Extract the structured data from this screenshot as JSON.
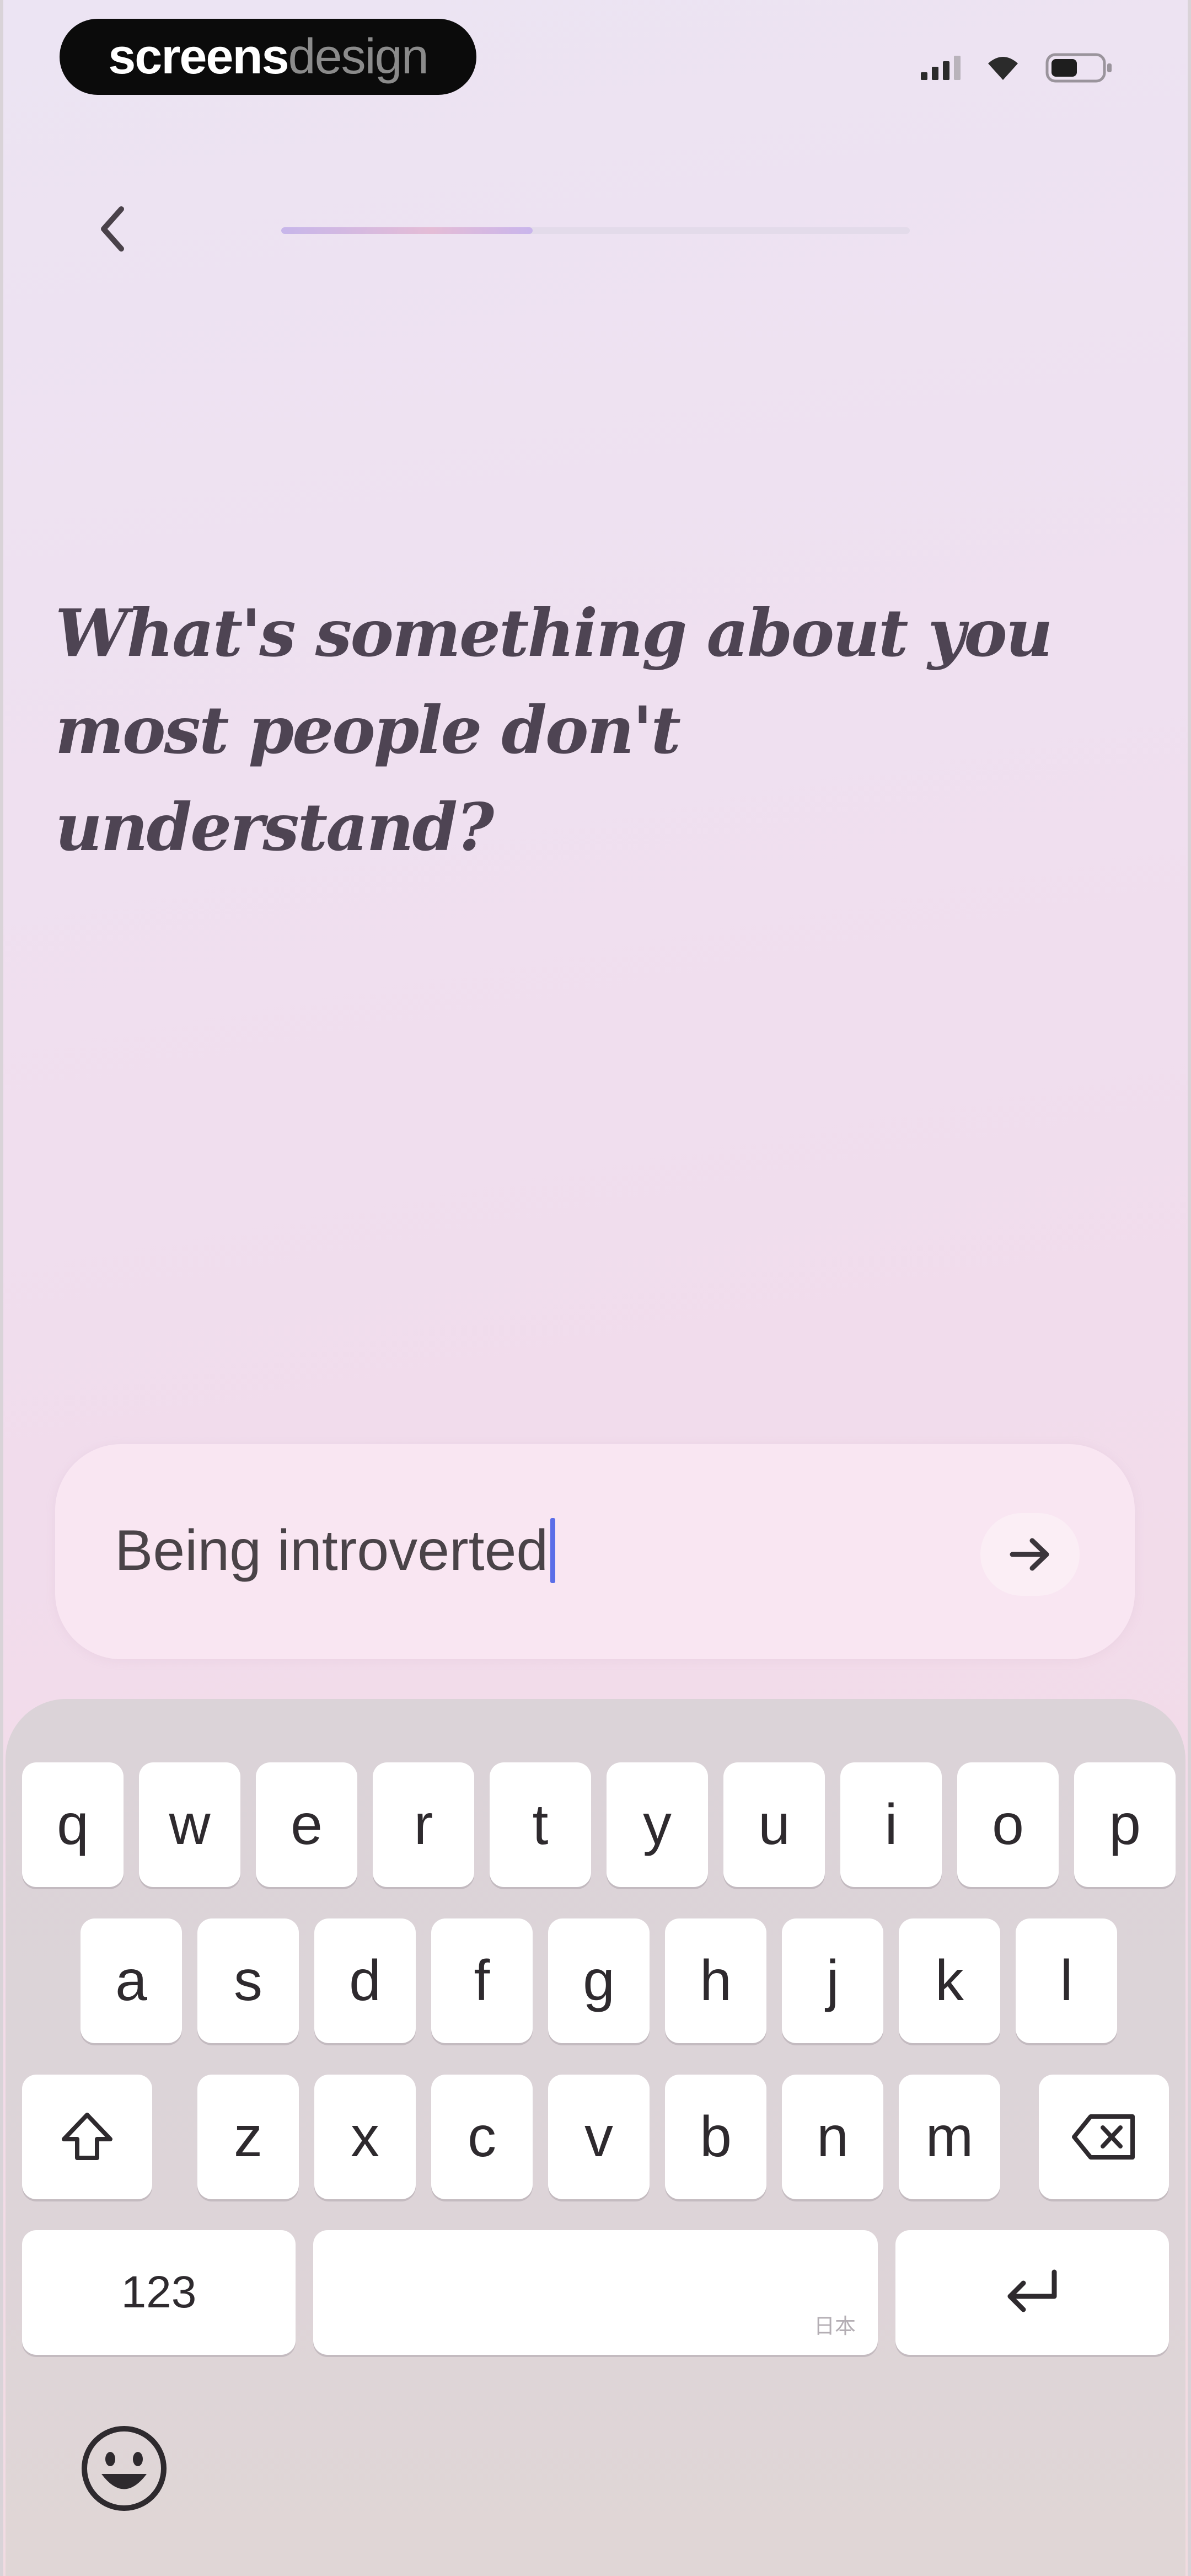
{
  "status_bar": {
    "brand_strong": "screens",
    "brand_light": "design",
    "icons": [
      "cellular-signal-icon",
      "wifi-icon",
      "battery-icon"
    ]
  },
  "header": {
    "back_icon": "chevron-left-icon",
    "progress": 0.4
  },
  "question": {
    "text": "What's something about you most people don't understand?"
  },
  "answer": {
    "value": "Being introverted",
    "send_icon": "arrow-right-icon"
  },
  "keyboard": {
    "row1": [
      "q",
      "w",
      "e",
      "r",
      "t",
      "y",
      "u",
      "i",
      "o",
      "p"
    ],
    "row2": [
      "a",
      "s",
      "d",
      "f",
      "g",
      "h",
      "j",
      "k",
      "l"
    ],
    "row3": [
      "z",
      "x",
      "c",
      "v",
      "b",
      "n",
      "m"
    ],
    "numbers_key": "123",
    "space_hint": "日本",
    "shift_icon": "shift-icon",
    "delete_icon": "backspace-icon",
    "return_icon": "return-icon",
    "emoji_icon": "emoji-icon"
  },
  "colors": {
    "accent_caret": "#5b6ee8",
    "question_text": "#4e4453",
    "progress_fill": "#c7b6ea"
  }
}
